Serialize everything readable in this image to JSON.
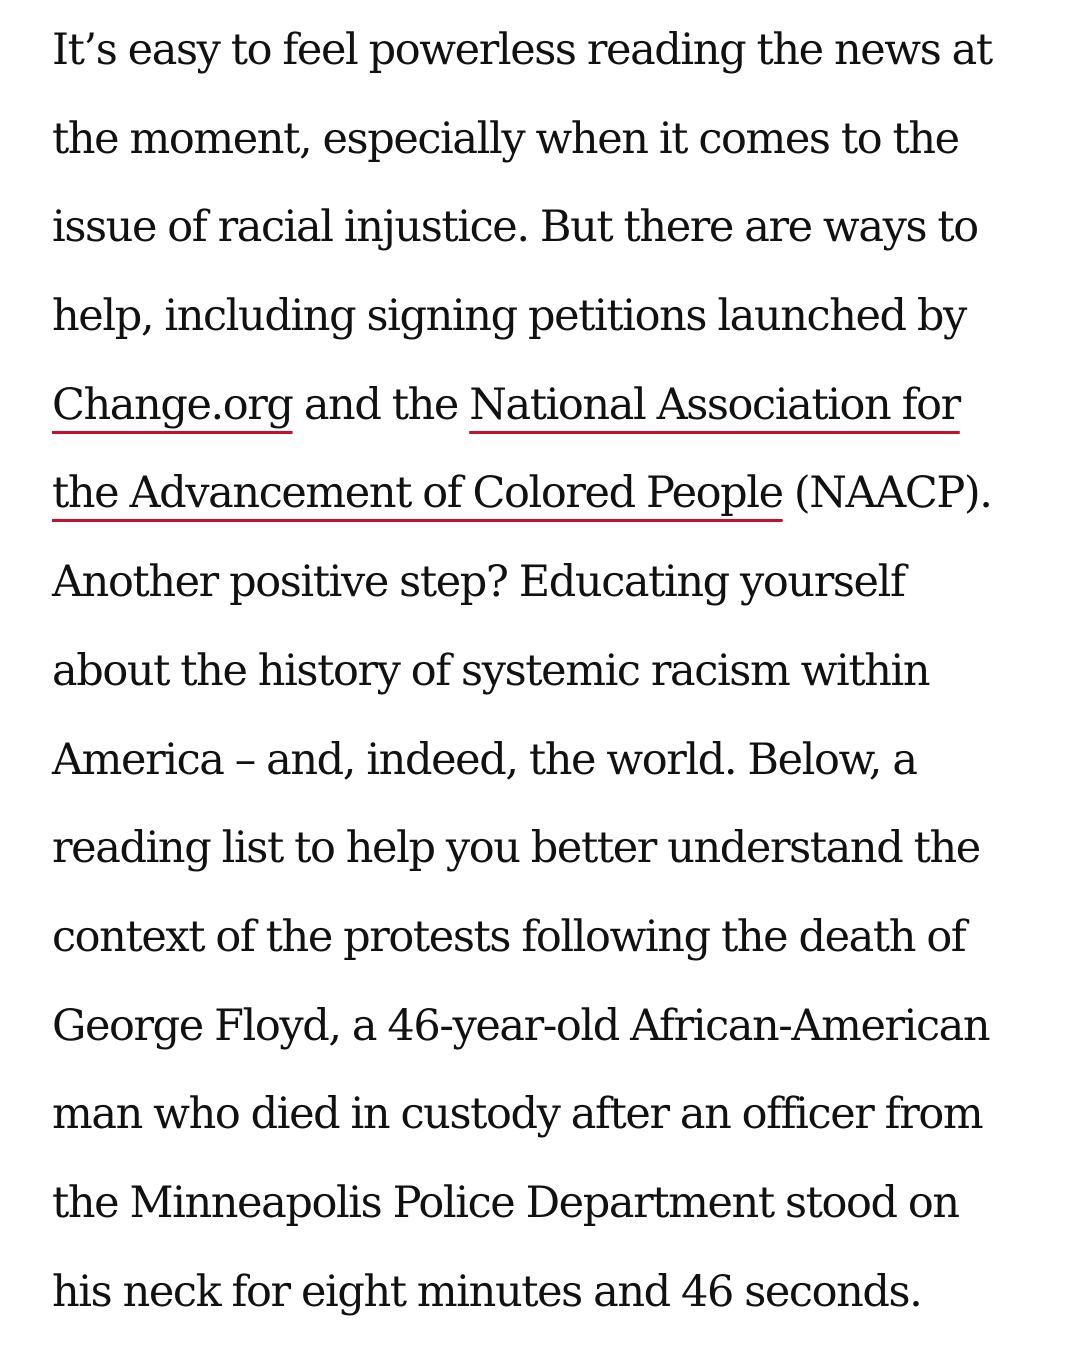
{
  "article": {
    "lines": [
      "It’s easy to feel powerless reading the news at",
      "the moment, especially when it comes to the",
      "issue of racial injustice. But there are ways to",
      "help, including signing petitions launched by",
      "",
      "",
      "Another positive step? Educating yourself",
      "about the history of systemic racism within",
      "America – and, indeed, the world. Below, a",
      "reading list to help you better understand the",
      "context of the protests following the death of",
      "George Floyd, a 46-year-old African-American",
      "man who died in custody after an officer from",
      "the Minneapolis Police Department stood on",
      "his neck for eight minutes and 46 seconds."
    ],
    "link_change_org": "Change.org",
    "text_and_the": " and the ",
    "link_naacp_part1": "National Association for",
    "link_naacp_part2": "the Advancement of Colored People",
    "text_naacp_abbr": " (NAACP).",
    "link_color": "#c8102e"
  }
}
